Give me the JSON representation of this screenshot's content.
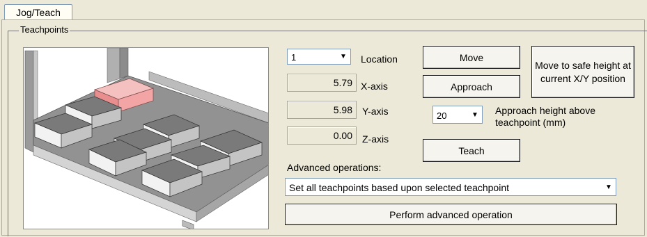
{
  "tab": {
    "label": "Jog/Teach"
  },
  "group": {
    "title": "Teachpoints"
  },
  "location": {
    "value": "1",
    "label": "Location"
  },
  "axes": {
    "x": {
      "value": "5.79",
      "label": "X-axis"
    },
    "y": {
      "value": "5.98",
      "label": "Y-axis"
    },
    "z": {
      "value": "0.00",
      "label": "Z-axis"
    }
  },
  "buttons": {
    "move": "Move",
    "approach": "Approach",
    "teach": "Teach",
    "safe_height": "Move to safe height at current X/Y position",
    "perform": "Perform advanced operation"
  },
  "approach_height": {
    "value": "20",
    "label": "Approach height above teachpoint (mm)"
  },
  "advanced": {
    "label": "Advanced operations:",
    "selected": "Set all teachpoints based upon selected teachpoint"
  },
  "colors": {
    "highlight_plate": "#f3a5a5",
    "plate": "#7d7d7d",
    "background": "#ece9d8"
  }
}
